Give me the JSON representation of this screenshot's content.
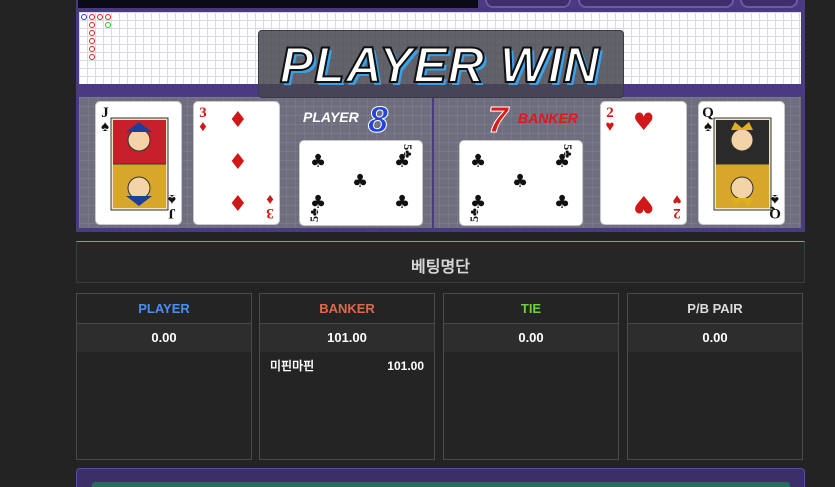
{
  "game": {
    "result_banner": "PLAYER WIN",
    "player": {
      "label": "PLAYER",
      "score": "8",
      "cards": [
        {
          "rank": "J",
          "suit": "♠",
          "color": "black"
        },
        {
          "rank": "3",
          "suit": "♦",
          "color": "red"
        },
        {
          "rank": "5",
          "suit": "♣",
          "color": "black"
        }
      ]
    },
    "banker": {
      "label": "BANKER",
      "score": "7",
      "cards": [
        {
          "rank": "5",
          "suit": "♣",
          "color": "black"
        },
        {
          "rank": "2",
          "suit": "♥",
          "color": "red"
        },
        {
          "rank": "Q",
          "suit": "♠",
          "color": "black"
        }
      ]
    },
    "colors": {
      "player_accent": "#2244e0",
      "banker_accent": "#e01818",
      "table_frame": "#4a3a82"
    }
  },
  "betting": {
    "title": "베팅명단",
    "columns": [
      {
        "name": "PLAYER",
        "total": "0.00",
        "color": "#4a8ef0",
        "rows": []
      },
      {
        "name": "BANKER",
        "total": "101.00",
        "color": "#e0684a",
        "rows": [
          {
            "user": "미핀마핀",
            "amount": "101.00"
          }
        ]
      },
      {
        "name": "TIE",
        "total": "0.00",
        "color": "#6ccf3c",
        "rows": []
      },
      {
        "name": "P/B PAIR",
        "total": "0.00",
        "color": "#dcdcdc",
        "rows": []
      }
    ]
  }
}
